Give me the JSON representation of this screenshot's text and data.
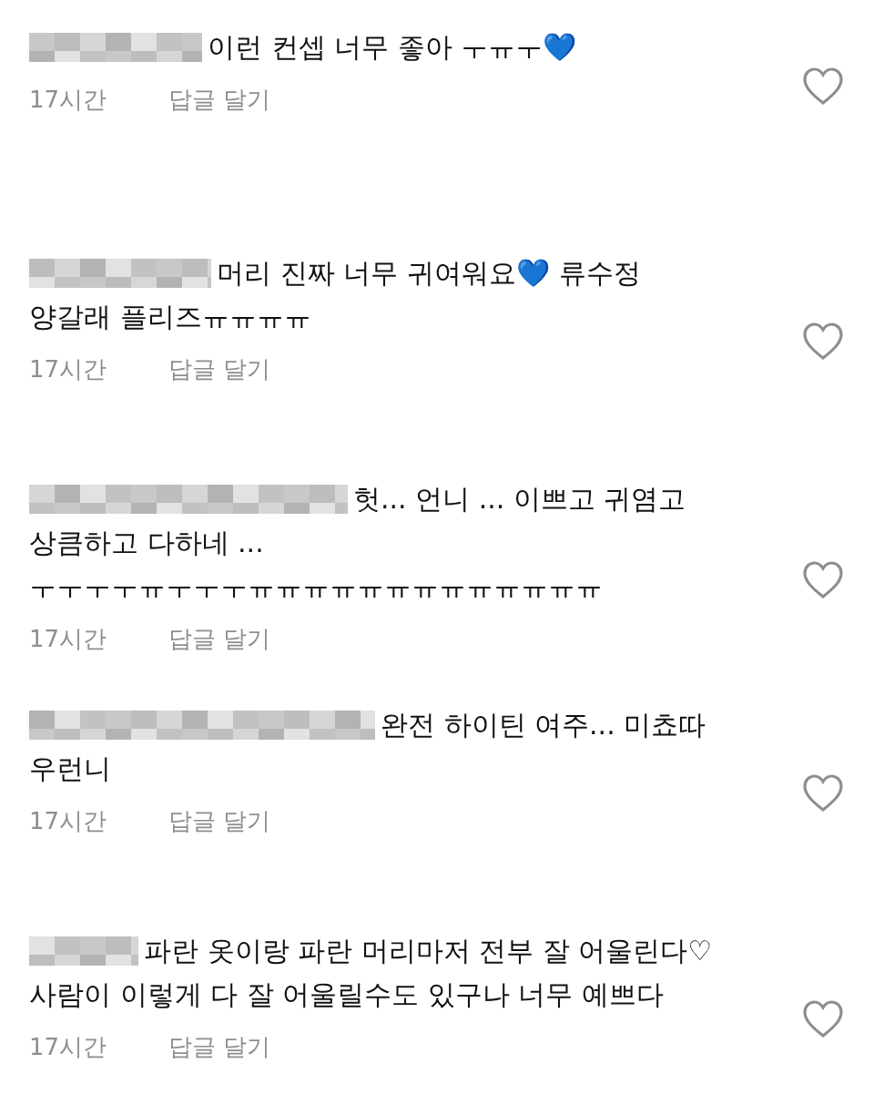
{
  "comments": [
    {
      "lines": [
        "이런 컨셉 너무 좋아 ㅜㅠㅜ💙"
      ],
      "time": "17시간",
      "reply": "답글 달기",
      "liked": false
    },
    {
      "lines": [
        "머리 진짜 너무 귀여워요💙 류수정",
        "양갈래 플리즈ㅠㅠㅠㅠ"
      ],
      "time": "17시간",
      "reply": "답글 달기",
      "liked": false
    },
    {
      "lines": [
        "헛... 언니 ... 이쁘고 귀염고",
        "상큼하고 다하네 ...",
        "ㅜㅜㅜㅜㅠㅜㅜㅜㅠㅠㅠㅠㅠㅠㅠㅠㅠㅠㅠㅠㅠ"
      ],
      "time": "17시간",
      "reply": "답글 달기",
      "liked": false
    },
    {
      "lines": [
        "완전 하이틴 여주... 미쵸따",
        "우런니"
      ],
      "time": "17시간",
      "reply": "답글 달기",
      "liked": false
    },
    {
      "lines": [
        "파란 옷이랑 파란 머리마저 전부 잘 어울린다♡",
        "사람이 이렇게 다 잘 어울릴수도 있구나 너무 예쁘다"
      ],
      "time": "17시간",
      "reply": "답글 달기",
      "liked": false
    }
  ]
}
